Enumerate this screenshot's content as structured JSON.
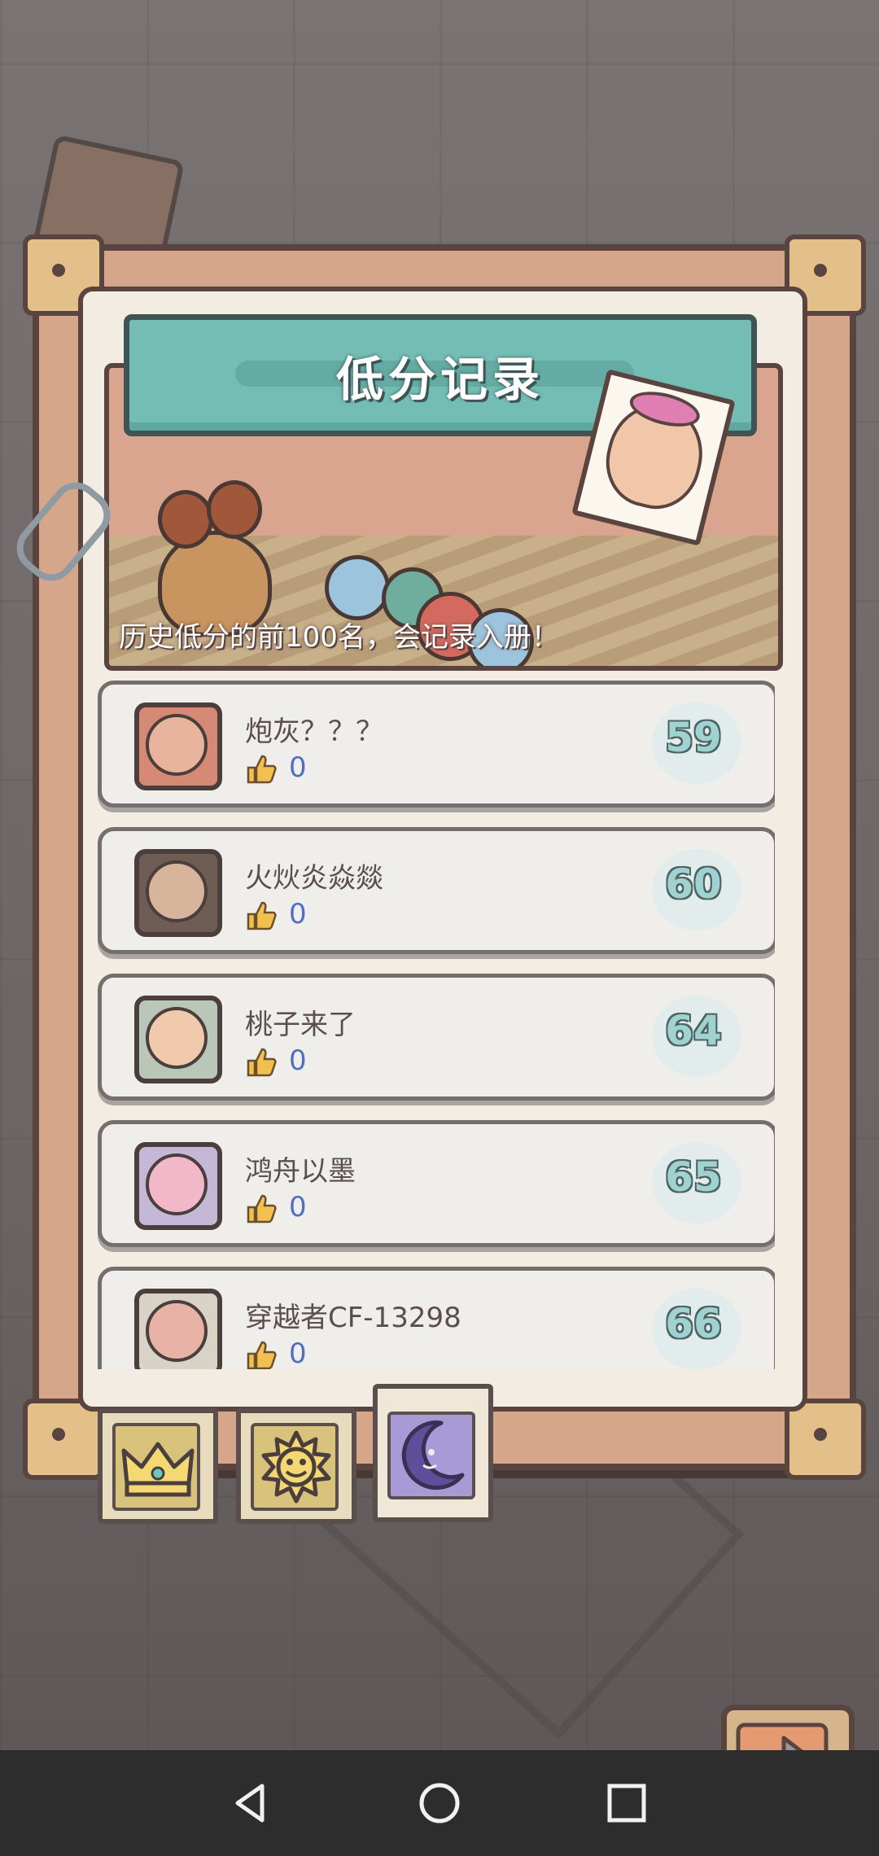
{
  "panel": {
    "title": "低分记录",
    "subtitle": "历史低分的前100名，会记录入册！"
  },
  "records": [
    {
      "name": "炮灰？？？",
      "likes": "0",
      "score": "59",
      "avatar": "red-haired-man-avatar"
    },
    {
      "name": "火炏炎焱燚",
      "likes": "0",
      "score": "60",
      "avatar": "long-haired-man-avatar"
    },
    {
      "name": "桃子来了",
      "likes": "0",
      "score": "64",
      "avatar": "girl-avatar"
    },
    {
      "name": "鸿舟以墨",
      "likes": "0",
      "score": "65",
      "avatar": "pink-creature-avatar"
    },
    {
      "name": "穿越者CF-13298",
      "likes": "0",
      "score": "66",
      "avatar": "snail-avatar"
    }
  ],
  "tabs": [
    {
      "icon": "crown-icon"
    },
    {
      "icon": "sun-icon"
    },
    {
      "icon": "moon-icon",
      "selected": true
    }
  ],
  "colors": {
    "title_bar": "#73bdb5",
    "likes": "#4f6fc2",
    "score_fill": "#9fd2d0",
    "selected_tab": "#a89ad6"
  },
  "navigation": {
    "back": "back-icon",
    "home": "home-icon",
    "recents": "recents-icon",
    "next": "arrow-right-icon"
  }
}
